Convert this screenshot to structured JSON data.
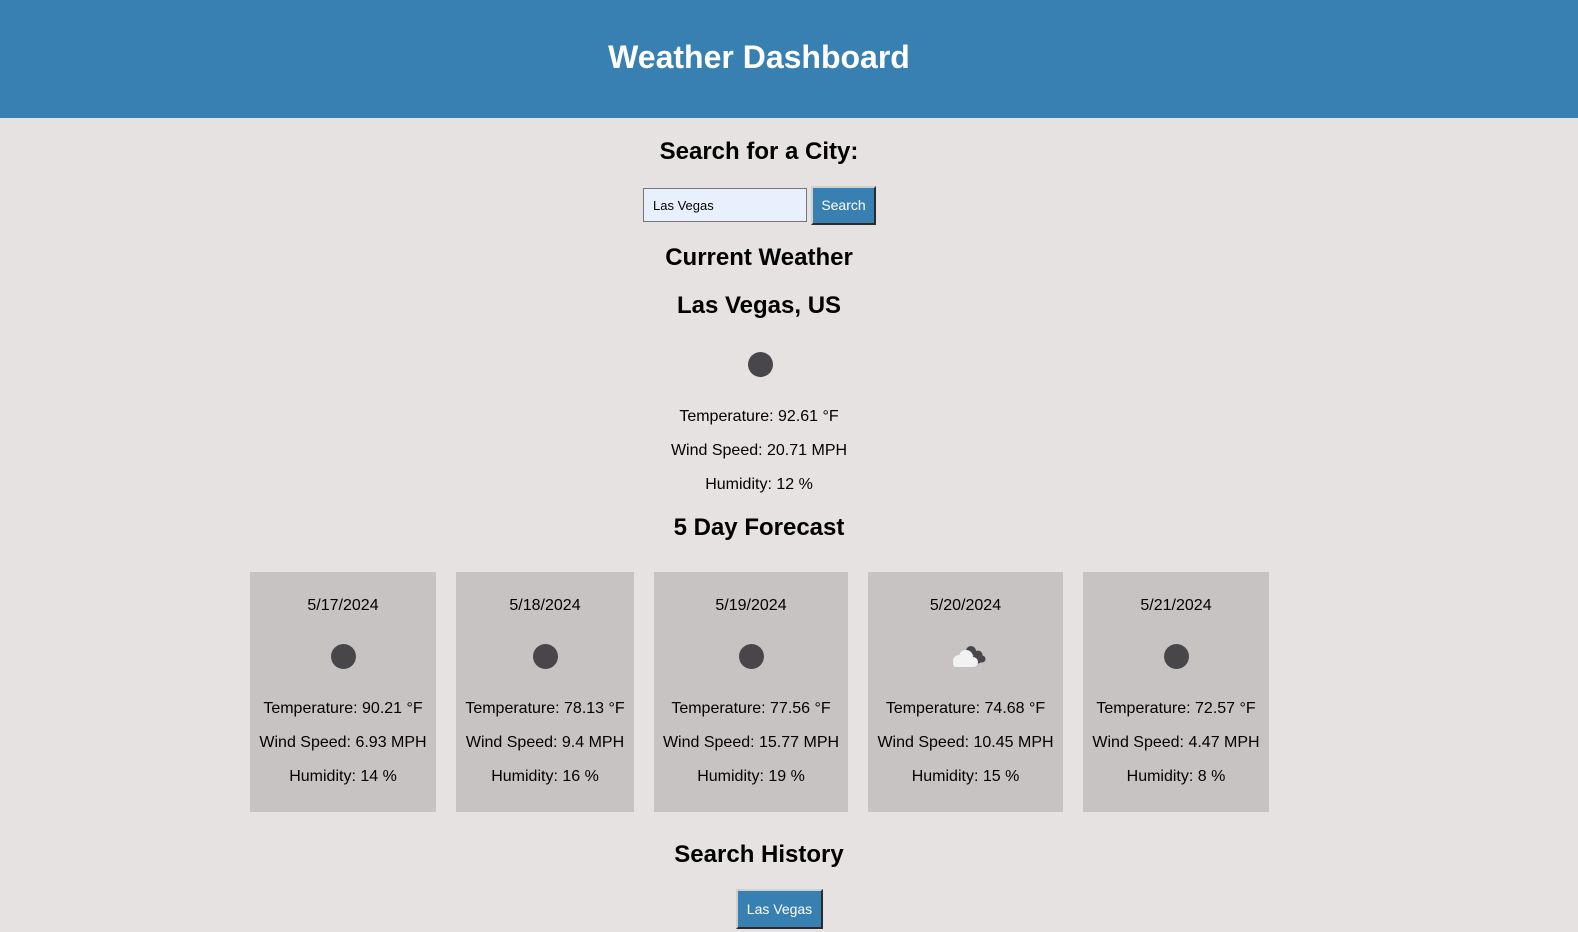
{
  "header": {
    "title": "Weather Dashboard"
  },
  "search": {
    "heading": "Search for a City:",
    "input_value": "Las Vegas",
    "button_label": "Search"
  },
  "current": {
    "heading": "Current Weather",
    "city": "Las Vegas, US",
    "icon": "weather-dot-icon",
    "temperature": "Temperature: 92.61 °F",
    "wind": "Wind Speed: 20.71 MPH",
    "humidity": "Humidity: 12 %"
  },
  "forecast": {
    "heading": "5 Day Forecast",
    "days": [
      {
        "date": "5/17/2024",
        "icon": "weather-dot-icon",
        "temperature": "Temperature: 90.21 °F",
        "wind": "Wind Speed: 6.93 MPH",
        "humidity": "Humidity: 14 %"
      },
      {
        "date": "5/18/2024",
        "icon": "weather-dot-icon",
        "temperature": "Temperature: 78.13 °F",
        "wind": "Wind Speed: 9.4 MPH",
        "humidity": "Humidity: 16 %"
      },
      {
        "date": "5/19/2024",
        "icon": "weather-dot-icon",
        "temperature": "Temperature: 77.56 °F",
        "wind": "Wind Speed: 15.77 MPH",
        "humidity": "Humidity: 19 %"
      },
      {
        "date": "5/20/2024",
        "icon": "cloud-icon",
        "temperature": "Temperature: 74.68 °F",
        "wind": "Wind Speed: 10.45 MPH",
        "humidity": "Humidity: 15 %"
      },
      {
        "date": "5/21/2024",
        "icon": "weather-dot-icon",
        "temperature": "Temperature: 72.57 °F",
        "wind": "Wind Speed: 4.47 MPH",
        "humidity": "Humidity: 8 %"
      }
    ]
  },
  "history": {
    "heading": "Search History",
    "items": [
      "Las Vegas"
    ]
  },
  "colors": {
    "header_bg": "#3780b1",
    "page_bg": "#e6e2e1",
    "card_bg": "#c7c3c2",
    "icon_dark": "#48464a"
  }
}
